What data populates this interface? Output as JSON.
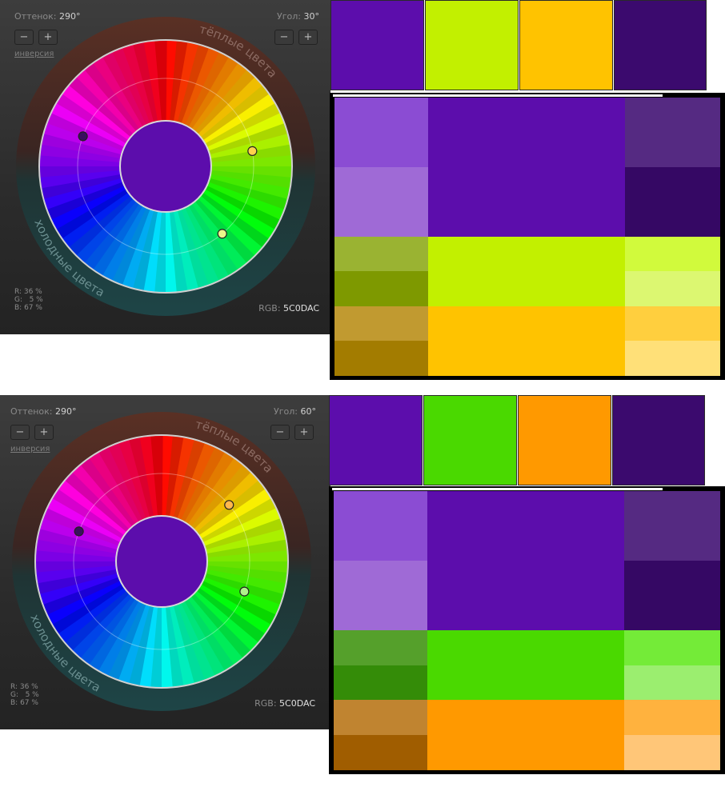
{
  "panels": [
    {
      "hue_label": "Оттенок:",
      "hue_value": "290°",
      "angle_label": "Угол:",
      "angle_value": "30°",
      "minus": "−",
      "plus": "+",
      "inversion": "инверсия",
      "warm": "тёплые цвета",
      "cold": "холодные цвета",
      "r": "R: 36 %",
      "g": "G:   5 %",
      "b": "B: 67 %",
      "rgb_label": "RGB:",
      "rgb_hex": "5C0DAC",
      "markers": [
        {
          "color": "#3a0f5e",
          "hue": 290
        },
        {
          "color": "#ffd24d",
          "hue": 80
        },
        {
          "color": "#e9f78a",
          "hue": 140
        }
      ],
      "swatches": [
        "#5c0dac",
        "#c2f000",
        "#ffc300",
        "#3b0a6e"
      ],
      "grid": {
        "left": [
          "#8b4cd3",
          "#9f6ad6",
          "#9ab332",
          "#7e9900",
          "#c19a30",
          "#a37c00"
        ],
        "main": [
          "#5c0dac",
          "#c2f000",
          "#ffc300"
        ],
        "right": [
          "#552a82",
          "#350864",
          "#d1fa3c",
          "#dcf771",
          "#ffcf3e",
          "#ffe078"
        ]
      }
    },
    {
      "hue_label": "Оттенок:",
      "hue_value": "290°",
      "angle_label": "Угол:",
      "angle_value": "60°",
      "minus": "−",
      "plus": "+",
      "inversion": "инверсия",
      "warm": "тёплые цвета",
      "cold": "холодные цвета",
      "r": "R: 36 %",
      "g": "G:   5 %",
      "b": "B: 67 %",
      "rgb_label": "RGB:",
      "rgb_hex": "5C0DAC",
      "markers": [
        {
          "color": "#3a0f5e",
          "hue": 290
        },
        {
          "color": "#ffb84d",
          "hue": 50
        },
        {
          "color": "#aef28a",
          "hue": 110
        }
      ],
      "swatches": [
        "#5c0dac",
        "#4ad900",
        "#ff9900",
        "#3b0a6e"
      ],
      "grid": {
        "left": [
          "#8b4cd3",
          "#9f6ad6",
          "#55a02b",
          "#348c08",
          "#c08430",
          "#a05d00"
        ],
        "main": [
          "#5c0dac",
          "#4ad900",
          "#ff9900"
        ],
        "right": [
          "#552a82",
          "#350864",
          "#74eb38",
          "#9bee6f",
          "#ffb23e",
          "#ffc678"
        ]
      }
    }
  ]
}
